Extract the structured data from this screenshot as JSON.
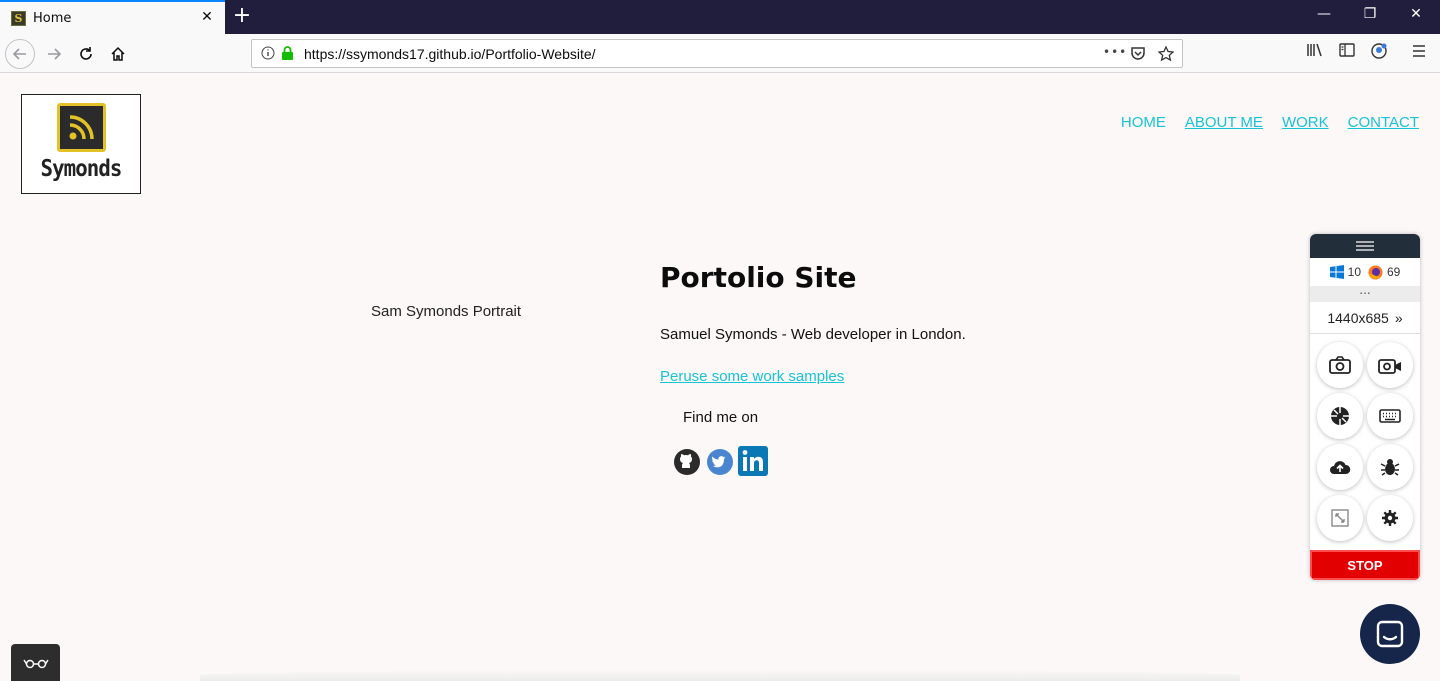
{
  "browser": {
    "tab_title": "Home",
    "tab_close": "✕",
    "new_tab": "+",
    "url": "https://ssymonds17.github.io/Portfolio-Website/",
    "url_more": "•••",
    "window_min": "—",
    "window_max": "❐",
    "window_close": "✕"
  },
  "site": {
    "logo_text": "Symonds",
    "nav": [
      "HOME",
      "ABOUT ME",
      "WORK",
      "CONTACT"
    ],
    "portrait_alt": "Sam Symonds Portrait",
    "title": "Portolio Site",
    "tagline": "Samuel Symonds - Web developer in London.",
    "work_link": "Peruse some work samples",
    "find_me": "Find me on",
    "social_icons": [
      "github-icon",
      "twitter-icon",
      "linkedin-icon"
    ]
  },
  "tool_panel": {
    "os_version": "10",
    "browser_version": "69",
    "dots": "...",
    "resolution": "1440x685",
    "resolution_arrow": "»",
    "stop_label": "STOP"
  },
  "colors": {
    "accent": "#17c3d5",
    "tab_bar": "#201d3d",
    "stop": "#e20000",
    "chat": "#16264a",
    "page_bg": "#fbf8f7"
  }
}
